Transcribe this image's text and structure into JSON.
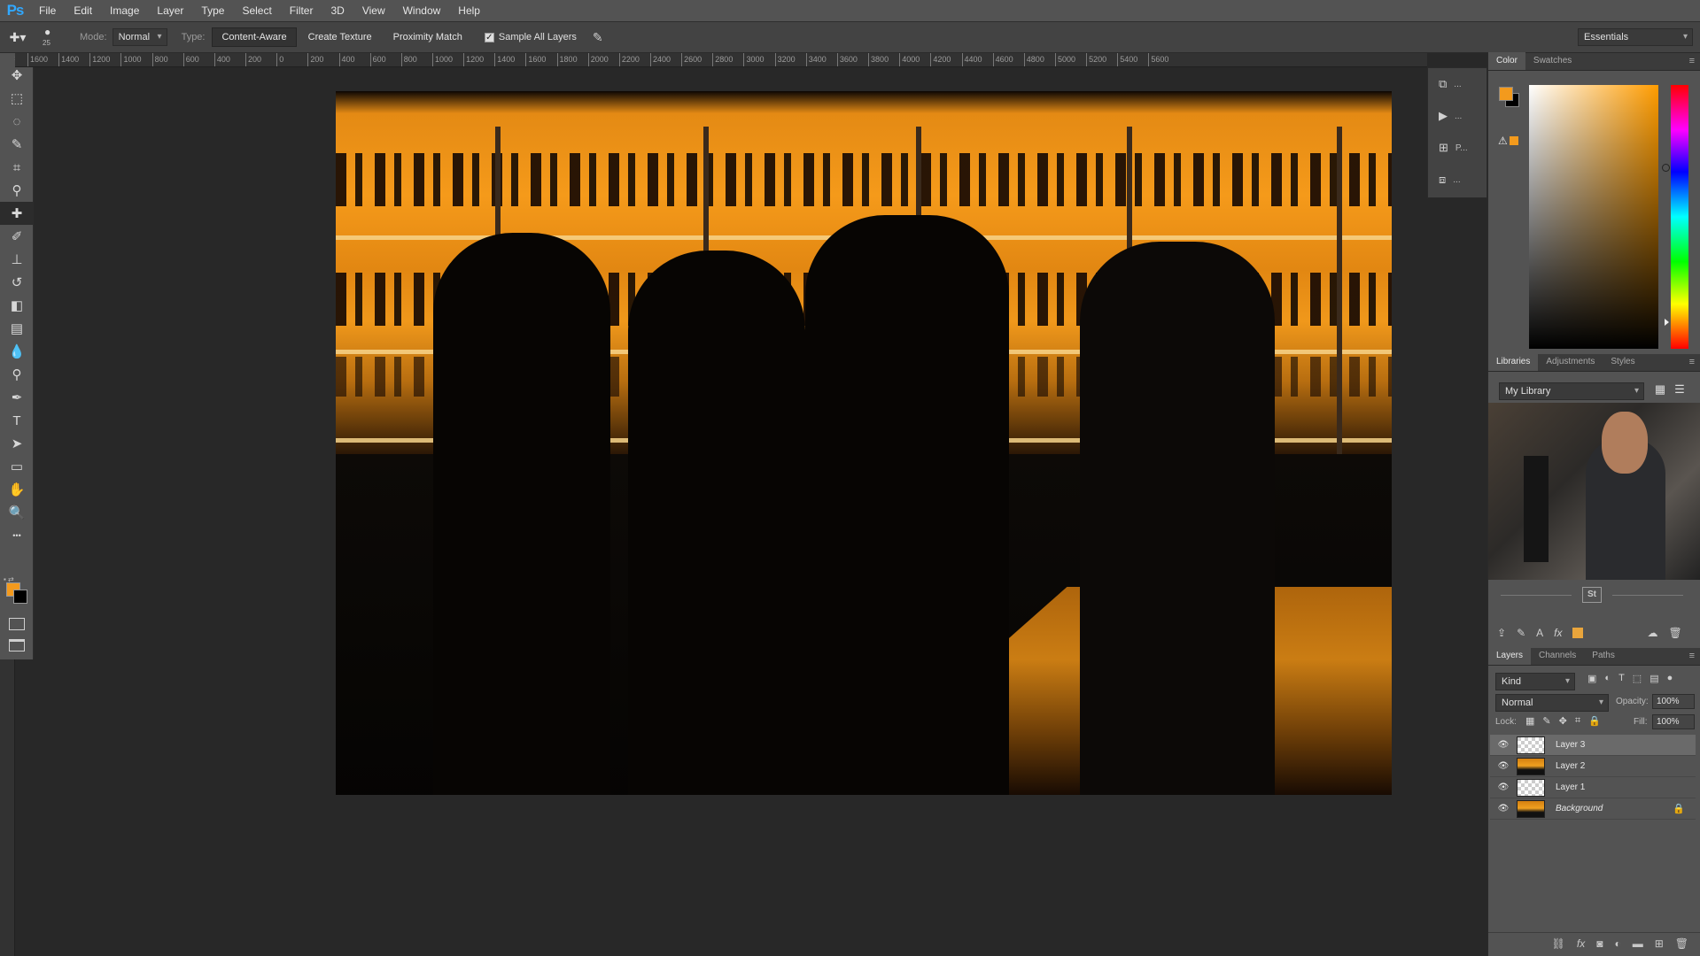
{
  "app": {
    "logo": "Ps",
    "menu": [
      "File",
      "Edit",
      "Image",
      "Layer",
      "Type",
      "Select",
      "Filter",
      "3D",
      "View",
      "Window",
      "Help"
    ]
  },
  "options_bar": {
    "brush_size": "25",
    "mode_label": "Mode:",
    "mode_value": "Normal",
    "type_label": "Type:",
    "type_options": [
      "Content-Aware",
      "Create Texture",
      "Proximity Match"
    ],
    "type_selected": "Content-Aware",
    "sample_all_layers_label": "Sample All Layers",
    "sample_all_layers_checked": true,
    "workspace": "Essentials"
  },
  "ruler": {
    "labels": [
      "1600",
      "1400",
      "1200",
      "1000",
      "800",
      "600",
      "400",
      "200",
      "0",
      "200",
      "400",
      "600",
      "800",
      "1000",
      "1200",
      "1400",
      "1600",
      "1800",
      "2000",
      "2200",
      "2400",
      "2600",
      "2800",
      "3000",
      "3200",
      "3400",
      "3600",
      "3800",
      "4000",
      "4200",
      "4400",
      "4600",
      "4800",
      "5000",
      "5200",
      "5400",
      "5600"
    ]
  },
  "toolbar": {
    "tools": [
      {
        "name": "move-tool",
        "icon": "move-icon",
        "glyph": "✥",
        "active": false
      },
      {
        "name": "marquee-tool",
        "icon": "marquee-icon",
        "glyph": "⬚",
        "active": false
      },
      {
        "name": "lasso-tool",
        "icon": "lasso-icon",
        "glyph": "◌",
        "active": false
      },
      {
        "name": "quick-select-tool",
        "icon": "quick-select-icon",
        "glyph": "✎",
        "active": false
      },
      {
        "name": "crop-tool",
        "icon": "crop-icon",
        "glyph": "⌗",
        "active": false
      },
      {
        "name": "eyedropper-tool",
        "icon": "eyedropper-icon",
        "glyph": "⚲",
        "active": false
      },
      {
        "name": "healing-brush-tool",
        "icon": "bandage-icon",
        "glyph": "✚",
        "active": true
      },
      {
        "name": "brush-tool",
        "icon": "brush-icon",
        "glyph": "✐",
        "active": false
      },
      {
        "name": "clone-stamp-tool",
        "icon": "stamp-icon",
        "glyph": "⊥",
        "active": false
      },
      {
        "name": "history-brush-tool",
        "icon": "history-brush-icon",
        "glyph": "↺",
        "active": false
      },
      {
        "name": "eraser-tool",
        "icon": "eraser-icon",
        "glyph": "◧",
        "active": false
      },
      {
        "name": "gradient-tool",
        "icon": "gradient-icon",
        "glyph": "▤",
        "active": false
      },
      {
        "name": "blur-tool",
        "icon": "droplet-icon",
        "glyph": "💧",
        "active": false
      },
      {
        "name": "dodge-tool",
        "icon": "dodge-icon",
        "glyph": "⚲",
        "active": false
      },
      {
        "name": "pen-tool",
        "icon": "pen-icon",
        "glyph": "✒",
        "active": false
      },
      {
        "name": "type-tool",
        "icon": "type-icon",
        "glyph": "T",
        "active": false
      },
      {
        "name": "path-select-tool",
        "icon": "arrow-icon",
        "glyph": "➤",
        "active": false
      },
      {
        "name": "shape-tool",
        "icon": "rectangle-icon",
        "glyph": "▭",
        "active": false
      },
      {
        "name": "hand-tool",
        "icon": "hand-icon",
        "glyph": "✋",
        "active": false
      },
      {
        "name": "zoom-tool",
        "icon": "zoom-icon",
        "glyph": "🔍",
        "active": false
      },
      {
        "name": "more-tools",
        "icon": "ellipsis-icon",
        "glyph": "•••",
        "active": false
      }
    ],
    "fg_color": "#f39a1d",
    "bg_color": "#000000"
  },
  "dock_mini": [
    {
      "icon": "history-icon",
      "glyph": "⧉",
      "label": "..."
    },
    {
      "icon": "actions-play-icon",
      "glyph": "▶",
      "label": "..."
    },
    {
      "icon": "properties-icon",
      "glyph": "⊞",
      "label": "P..."
    },
    {
      "icon": "clone-source-icon",
      "glyph": "⧈",
      "label": "..."
    }
  ],
  "color_panel": {
    "tabs": [
      "Color",
      "Swatches"
    ],
    "active_tab": "Color",
    "fg_color": "#f39a1d",
    "bg_color": "#000000",
    "gamut_color": "#f39a1d",
    "warning_glyph": "⚠"
  },
  "libraries_panel": {
    "tabs": [
      "Libraries",
      "Adjustments",
      "Styles"
    ],
    "active_tab": "Libraries",
    "library": "My Library",
    "stock_label": "St",
    "swatch_color": "#e9a53c"
  },
  "layers_panel": {
    "tabs": [
      "Layers",
      "Channels",
      "Paths"
    ],
    "active_tab": "Layers",
    "kind_filter": "Kind",
    "blend_mode": "Normal",
    "opacity_label": "Opacity:",
    "opacity": "100%",
    "lock_label": "Lock:",
    "fill_label": "Fill:",
    "fill": "100%",
    "layers": [
      {
        "name": "Layer 3",
        "selected": true,
        "thumb": "checker",
        "italic": false,
        "locked": false
      },
      {
        "name": "Layer 2",
        "selected": false,
        "thumb": "photo",
        "italic": false,
        "locked": false
      },
      {
        "name": "Layer 1",
        "selected": false,
        "thumb": "checker",
        "italic": false,
        "locked": false
      },
      {
        "name": "Background",
        "selected": false,
        "thumb": "photo",
        "italic": true,
        "locked": true
      }
    ]
  }
}
